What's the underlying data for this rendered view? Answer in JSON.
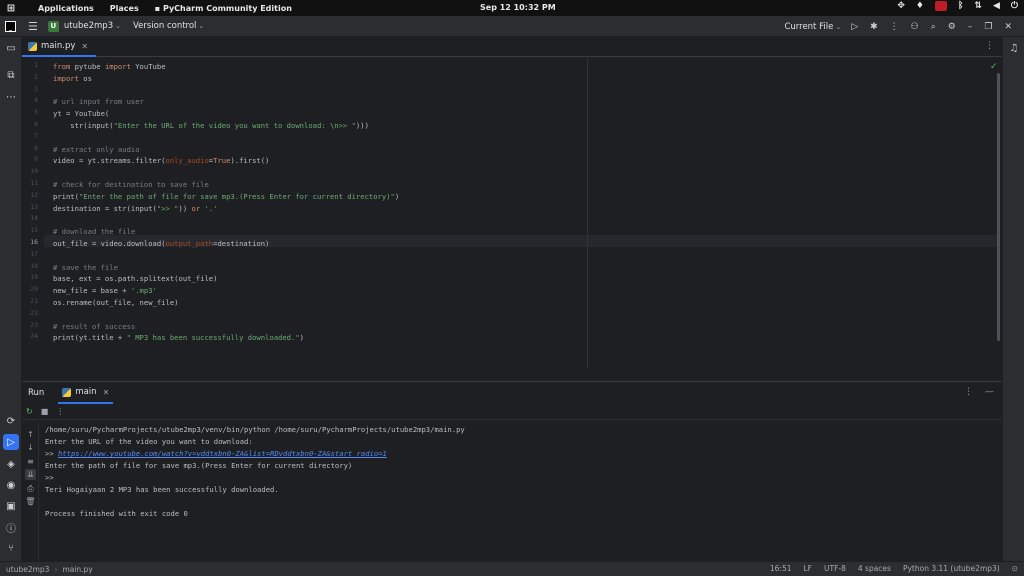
{
  "system_bar": {
    "activities_icon": "apps-grid-icon",
    "applications": "Applications",
    "places": "Places",
    "app_menu": "PyCharm Community Edition",
    "clock": "Sep 12  10:32 PM"
  },
  "titlebar": {
    "project_initial": "U",
    "project": "utube2mp3",
    "vcs": "Version control",
    "run_config": "Current File"
  },
  "editor": {
    "tab": "main.py",
    "lines": [
      {
        "n": "1",
        "tokens": [
          {
            "t": "from ",
            "c": "kw"
          },
          {
            "t": "pytube ",
            "c": ""
          },
          {
            "t": "import ",
            "c": "kw"
          },
          {
            "t": "YouTube",
            "c": ""
          }
        ]
      },
      {
        "n": "2",
        "tokens": [
          {
            "t": "import ",
            "c": "kw"
          },
          {
            "t": "os",
            "c": ""
          }
        ]
      },
      {
        "n": "3",
        "tokens": []
      },
      {
        "n": "4",
        "tokens": [
          {
            "t": "# url input from user",
            "c": "cmt"
          }
        ]
      },
      {
        "n": "5",
        "tokens": [
          {
            "t": "yt = YouTube(",
            "c": ""
          }
        ]
      },
      {
        "n": "6",
        "tokens": [
          {
            "t": "    str(input(",
            "c": ""
          },
          {
            "t": "\"Enter the URL of the video you want to download: \\n>> \"",
            "c": "str"
          },
          {
            "t": ")))",
            "c": ""
          }
        ]
      },
      {
        "n": "7",
        "tokens": []
      },
      {
        "n": "8",
        "tokens": [
          {
            "t": "# extract only audio",
            "c": "cmt"
          }
        ]
      },
      {
        "n": "9",
        "tokens": [
          {
            "t": "video = yt.streams.filter(",
            "c": ""
          },
          {
            "t": "only_audio",
            "c": "param"
          },
          {
            "t": "=",
            "c": ""
          },
          {
            "t": "True",
            "c": "kw"
          },
          {
            "t": ").first()",
            "c": ""
          }
        ]
      },
      {
        "n": "10",
        "tokens": []
      },
      {
        "n": "11",
        "tokens": [
          {
            "t": "# check for destination to save file",
            "c": "cmt"
          }
        ]
      },
      {
        "n": "12",
        "tokens": [
          {
            "t": "print(",
            "c": ""
          },
          {
            "t": "\"Enter the path of file for save mp3.(Press Enter for current directory)\"",
            "c": "str"
          },
          {
            "t": ")",
            "c": ""
          }
        ]
      },
      {
        "n": "13",
        "tokens": [
          {
            "t": "destination = str(input(",
            "c": ""
          },
          {
            "t": "\">> \"",
            "c": "str"
          },
          {
            "t": ")) ",
            "c": ""
          },
          {
            "t": "or ",
            "c": "kw"
          },
          {
            "t": "'.'",
            "c": "str"
          }
        ]
      },
      {
        "n": "14",
        "tokens": []
      },
      {
        "n": "15",
        "tokens": [
          {
            "t": "# download the file",
            "c": "cmt"
          }
        ]
      },
      {
        "n": "16",
        "tokens": [
          {
            "t": "out_file = video.download(",
            "c": ""
          },
          {
            "t": "output_path",
            "c": "param"
          },
          {
            "t": "=destination)",
            "c": ""
          }
        ]
      },
      {
        "n": "17",
        "tokens": []
      },
      {
        "n": "18",
        "tokens": [
          {
            "t": "# save the file",
            "c": "cmt"
          }
        ]
      },
      {
        "n": "19",
        "tokens": [
          {
            "t": "base, ext = os.path.splitext(out_file)",
            "c": ""
          }
        ]
      },
      {
        "n": "20",
        "tokens": [
          {
            "t": "new_file = base + ",
            "c": ""
          },
          {
            "t": "'.mp3'",
            "c": "str"
          }
        ]
      },
      {
        "n": "21",
        "tokens": [
          {
            "t": "os.rename(out_file, new_file)",
            "c": ""
          }
        ]
      },
      {
        "n": "22",
        "tokens": []
      },
      {
        "n": "23",
        "tokens": [
          {
            "t": "# result of success",
            "c": "cmt"
          }
        ]
      },
      {
        "n": "24",
        "tokens": [
          {
            "t": "print(yt.title + ",
            "c": ""
          },
          {
            "t": "\" MP3 has been successfully downloaded.\"",
            "c": "str"
          },
          {
            "t": ")",
            "c": ""
          }
        ]
      }
    ],
    "current_line": "16"
  },
  "run": {
    "title": "Run",
    "tab": "main",
    "output": [
      {
        "text": "/home/suru/PycharmProjects/utube2mp3/venv/bin/python /home/suru/PycharmProjects/utube2mp3/main.py"
      },
      {
        "text": "Enter the URL of the video you want to download: "
      },
      {
        "text": ">> ",
        "link": "https://www.youtube.com/watch?v=vddtxbn0-ZA&list=RDvddtxbn0-ZA&start_radio=1"
      },
      {
        "text": "Enter the path of file for save mp3.(Press Enter for current directory)"
      },
      {
        "text": ">> "
      },
      {
        "text": "Teri Hogaiyaan 2 MP3 has been successfully downloaded."
      },
      {
        "text": ""
      },
      {
        "text": "Process finished with exit code 0"
      }
    ]
  },
  "status": {
    "project": "utube2mp3",
    "file": "main.py",
    "position": "16:51",
    "line_sep": "LF",
    "encoding": "UTF-8",
    "indent": "4 spaces",
    "interpreter": "Python 3.11 (utube2mp3)"
  },
  "colors": {
    "accent": "#3574f0",
    "keyword": "#cf8e6d",
    "string": "#6aab73",
    "comment": "#7a7e85",
    "param": "#aa4926",
    "link": "#548af7",
    "run_green": "#5fb865"
  }
}
